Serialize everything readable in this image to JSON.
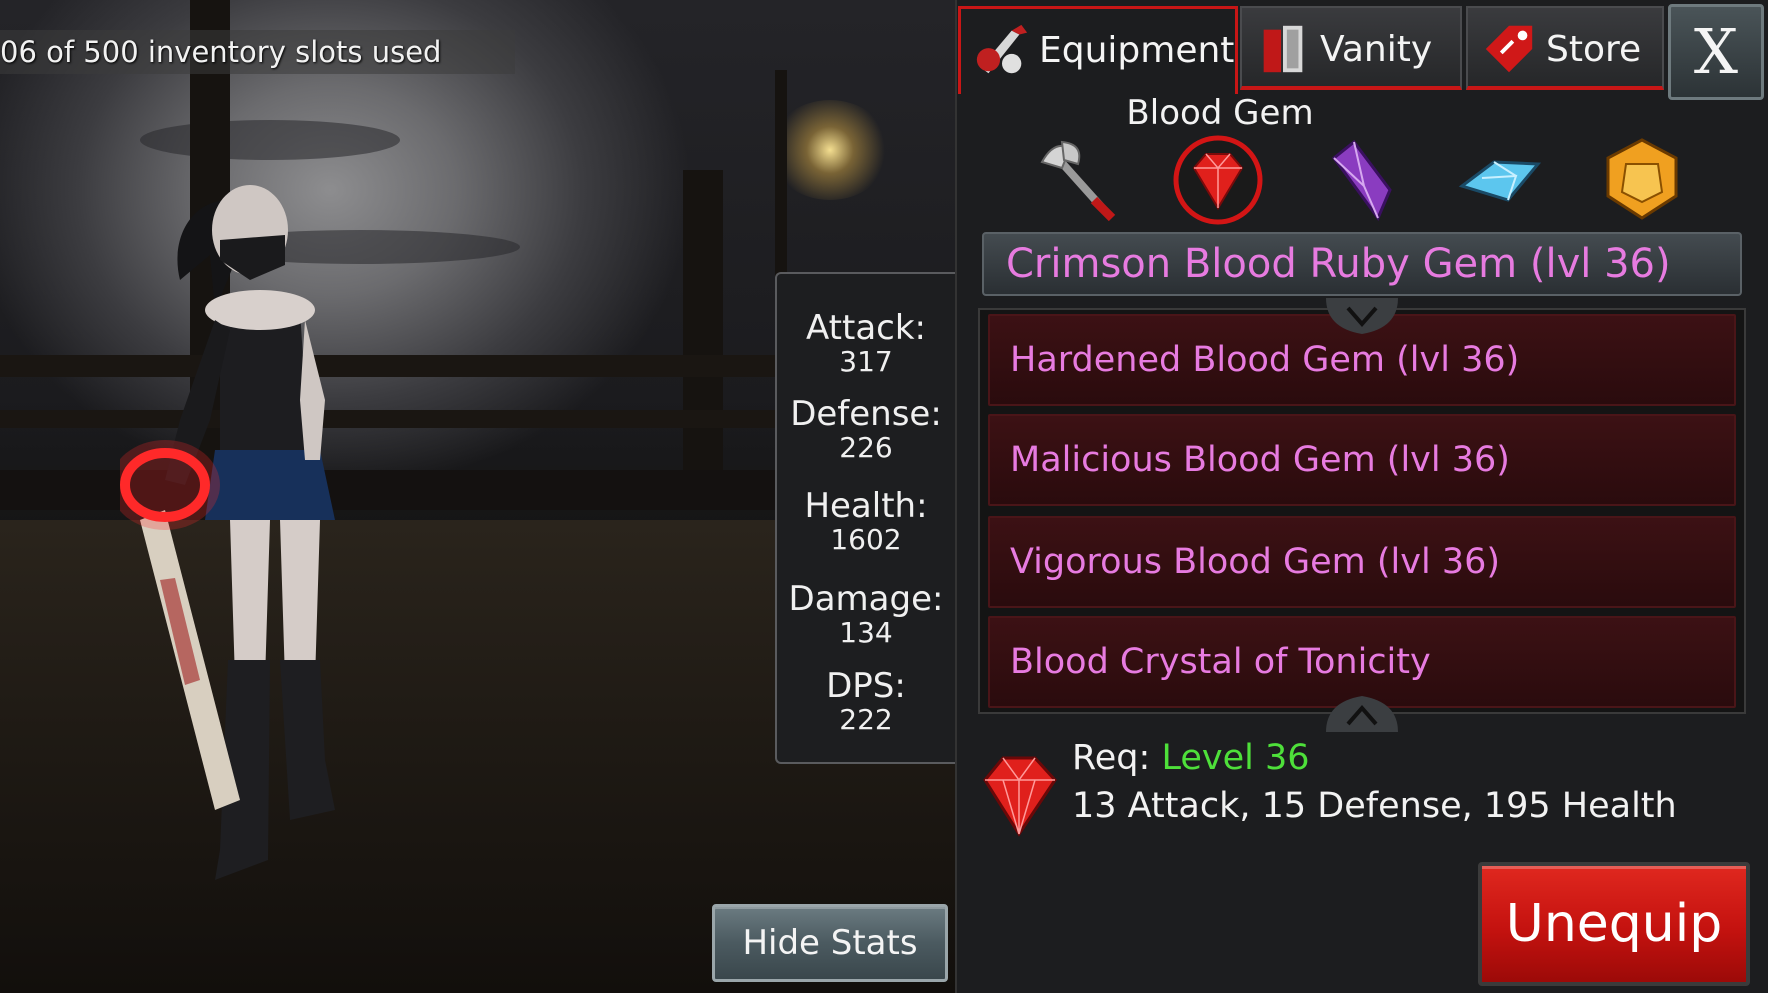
{
  "inventory": {
    "slots_text": "06 of 500 inventory slots used"
  },
  "stats": {
    "attack_label": "Attack:",
    "attack_value": "317",
    "defense_label": "Defense:",
    "defense_value": "226",
    "health_label": "Health:",
    "health_value": "1602",
    "damage_label": "Damage:",
    "damage_value": "134",
    "dps_label": "DPS:",
    "dps_value": "222"
  },
  "hide_stats_label": "Hide Stats",
  "tabs": [
    {
      "label": "Equipment",
      "icon": "equipment-icon",
      "active": true
    },
    {
      "label": "Vanity",
      "icon": "vanity-icon",
      "active": false
    },
    {
      "label": "Store",
      "icon": "store-icon",
      "active": false
    }
  ],
  "close_label": "X",
  "category_title": "Blood Gem",
  "gem_slots": [
    {
      "icon": "axe-icon",
      "selected": false
    },
    {
      "icon": "red-ruby-gem-icon",
      "selected": true
    },
    {
      "icon": "purple-crystal-gem-icon",
      "selected": false
    },
    {
      "icon": "blue-diamond-gem-icon",
      "selected": false
    },
    {
      "icon": "orange-topaz-gem-icon",
      "selected": false
    }
  ],
  "selected_item": "Crimson Blood Ruby Gem (lvl 36)",
  "item_list": [
    "Hardened Blood Gem (lvl 36)",
    "Malicious Blood Gem (lvl 36)",
    "Vigorous Blood Gem (lvl 36)",
    "Blood Crystal of Tonicity"
  ],
  "details": {
    "req_label": "Req:",
    "req_value": "Level 36",
    "bonus": "13 Attack, 15 Defense, 195 Health"
  },
  "unequip_label": "Unequip",
  "colors": {
    "item_text": "#e77be0",
    "req_value": "#4ee03a",
    "accent_red": "#c81616",
    "unequip_red": "#c4120f"
  }
}
